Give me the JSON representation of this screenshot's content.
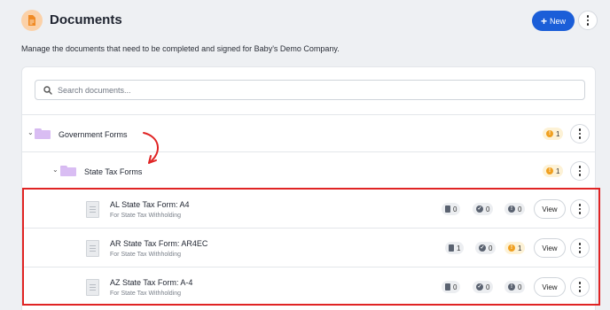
{
  "header": {
    "title": "Documents",
    "new_label": "New",
    "subtitle": "Manage the documents that need to be completed and signed for Baby's Demo Company."
  },
  "search": {
    "placeholder": "Search documents..."
  },
  "folders": [
    {
      "name": "Government Forms",
      "warning_count": "1"
    },
    {
      "name": "State Tax Forms",
      "warning_count": "1"
    }
  ],
  "documents": [
    {
      "title": "AL State Tax Form: A4",
      "subtitle": "For State Tax Withholding",
      "docs": "0",
      "completed": "0",
      "warnings": "0",
      "view_label": "View"
    },
    {
      "title": "AR State Tax Form: AR4EC",
      "subtitle": "For State Tax Withholding",
      "docs": "1",
      "completed": "0",
      "warnings": "1",
      "view_label": "View"
    },
    {
      "title": "AZ State Tax Form: A-4",
      "subtitle": "For State Tax Withholding",
      "docs": "0",
      "completed": "0",
      "warnings": "0",
      "view_label": "View"
    }
  ],
  "colors": {
    "accent": "#1b5ed8",
    "folder": "#d9bdf3",
    "warning": "#f0a020",
    "highlight": "#e02424"
  }
}
